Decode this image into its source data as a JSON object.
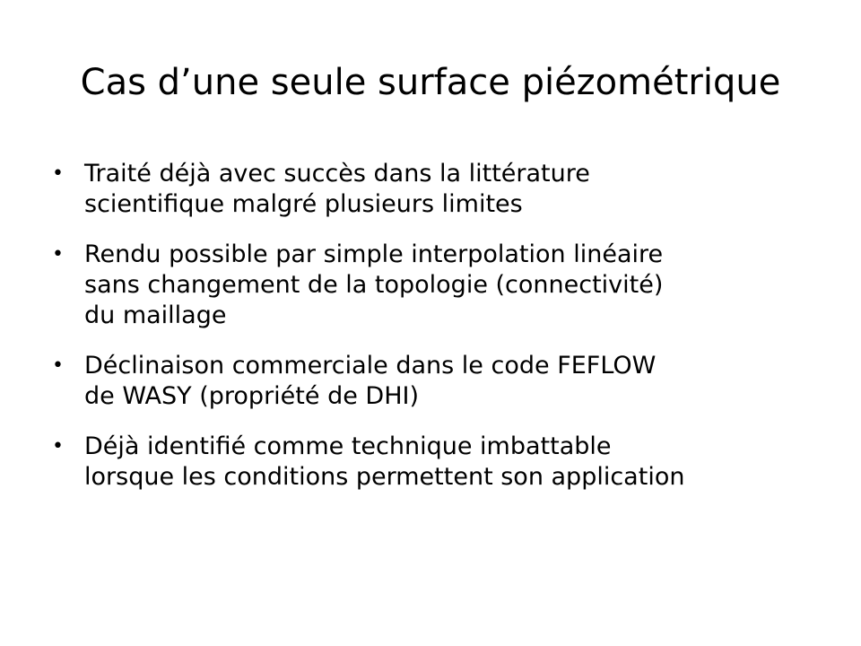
{
  "slide": {
    "title": "Cas d’une seule surface piézométrique",
    "bullet_symbol": "•",
    "bullets": [
      {
        "lines": [
          "Traité déjà avec succès dans la littérature",
          "scientifique malgré plusieurs limites"
        ]
      },
      {
        "lines": [
          "Rendu possible par simple interpolation linéaire",
          "sans changement de la topologie (connectivité)",
          "du maillage"
        ]
      },
      {
        "lines": [
          "Déclinaison commerciale dans le code FEFLOW",
          "de WASY (propriété de DHI)"
        ]
      },
      {
        "lines": [
          "Déjà identifié comme technique imbattable",
          "lorsque les conditions permettent son application"
        ]
      }
    ]
  }
}
